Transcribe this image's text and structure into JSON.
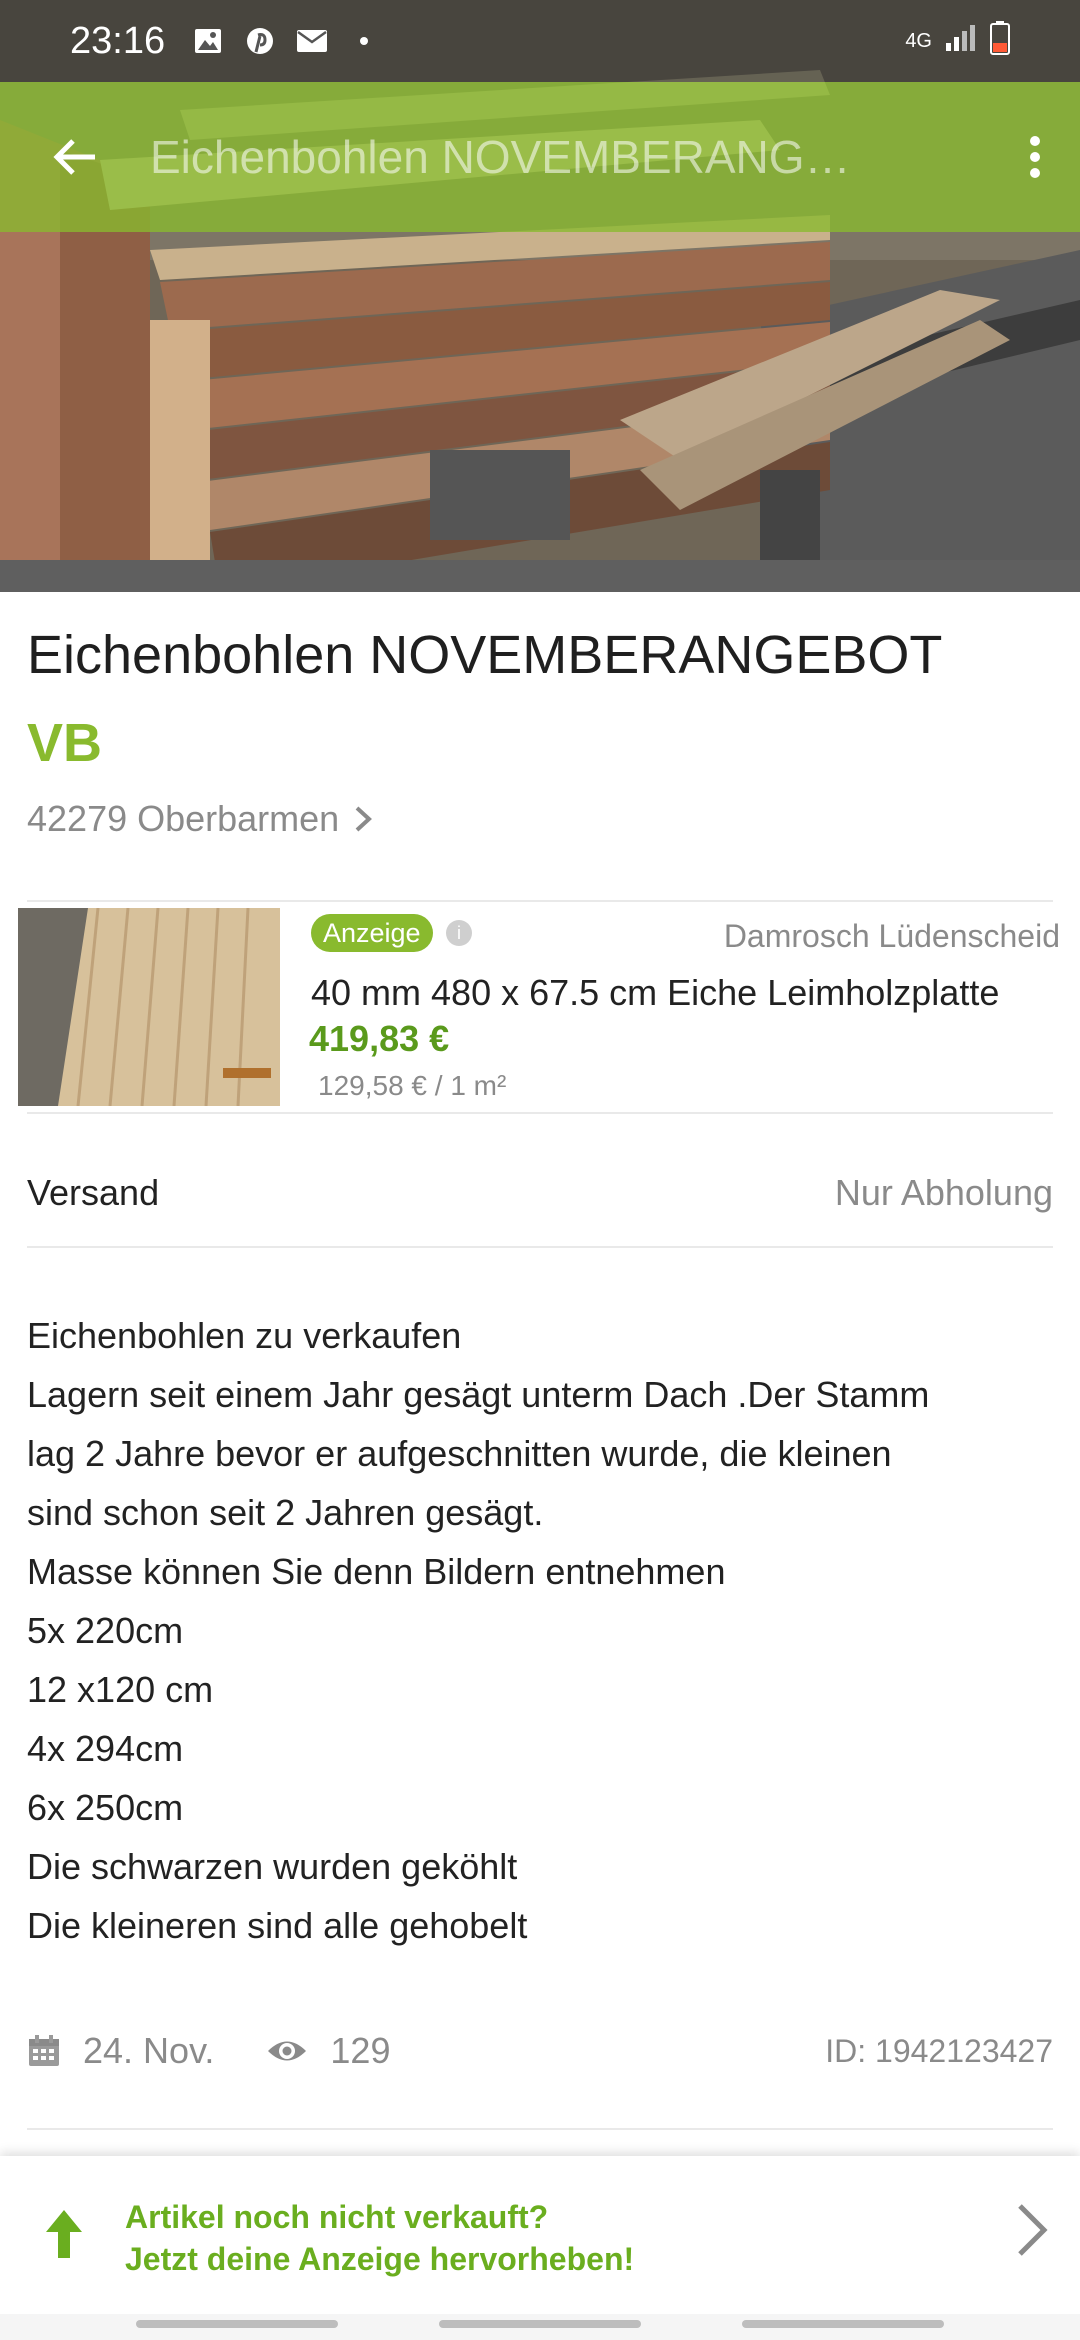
{
  "status_bar": {
    "time": "23:16",
    "network": "4G",
    "icons": [
      "image-icon",
      "pinterest-icon",
      "mail-icon",
      "dot-icon",
      "signal-icon",
      "battery-icon"
    ]
  },
  "toolbar": {
    "title": "Eichenbohlen NOVEMBERANG…",
    "back_icon": "arrow-left-icon",
    "more_icon": "more-vert-icon"
  },
  "listing": {
    "title": "Eichenbohlen NOVEMBERANGEBOT",
    "price": "VB",
    "location": "42279 Oberbarmen"
  },
  "ad": {
    "badge": "Anzeige",
    "seller": "Damrosch Lüdenscheid",
    "headline": "40 mm 480 x 67.5 cm Eiche Leimholzplatte",
    "price": "419,83 €",
    "unit_price": "129,58 € / 1 m²"
  },
  "shipping": {
    "label": "Versand",
    "value": "Nur Abholung"
  },
  "description": {
    "lines": [
      "Eichenbohlen zu verkaufen",
      "Lagern seit einem Jahr gesägt unterm Dach .Der Stamm",
      "lag 2 Jahre bevor er aufgeschnitten wurde, die kleinen",
      "sind schon seit 2 Jahren gesägt.",
      "Masse können Sie denn Bildern entnehmen",
      "5x 220cm",
      "12 x120 cm",
      "4x 294cm",
      "6x 250cm",
      "Die schwarzen wurden geköhlt",
      "Die kleineren sind alle gehobelt"
    ]
  },
  "meta": {
    "date": "24. Nov.",
    "views": "129",
    "id": "ID: 1942123427"
  },
  "promo": {
    "line1": "Artikel noch nicht verkauft?",
    "line2": "Jetzt deine Anzeige hervorheben!"
  },
  "colors": {
    "brand_green": "#89ba2e",
    "price_green": "#5a9a1c",
    "promo_green": "#6aae1f",
    "muted_text": "#8a8a8a"
  }
}
